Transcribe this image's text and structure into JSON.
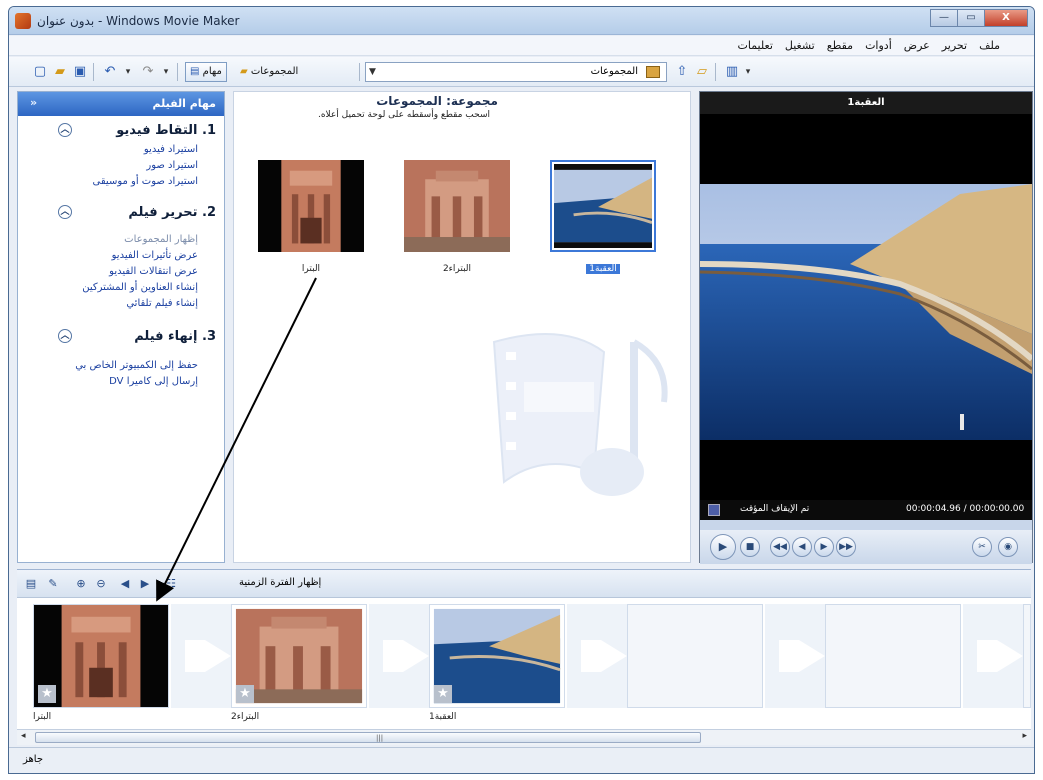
{
  "window": {
    "title": "بدون عنوان - Windows Movie Maker",
    "btn_min": "—",
    "btn_max": "▭",
    "btn_close": "X"
  },
  "menu": [
    "ملف",
    "تحرير",
    "عرض",
    "أدوات",
    "مقطع",
    "تشغيل",
    "تعليمات"
  ],
  "toolbar": {
    "tasks_label": "مهام",
    "collections_label": "المجموعات",
    "combo_value": "المجموعات"
  },
  "tasks": {
    "header": "مهام الفيلم",
    "close_glyph": "«",
    "sections": [
      {
        "title": "1. التقاط فيديو",
        "links": [
          "استيراد فيديو",
          "استيراد صور",
          "استيراد صوت أو موسيقى"
        ]
      },
      {
        "title": "2. تحرير فيلم",
        "links": [
          "إظهار المجموعات",
          "عرض تأثيرات الفيديو",
          "عرض انتقالات الفيديو",
          "إنشاء العناوين أو المشتركين",
          "إنشاء فيلم تلقائي"
        ]
      },
      {
        "title": "3. إنهاء فيلم",
        "links": [
          "حفظ إلى الكمبيوتر الخاص بي",
          "إرسال إلى كاميرا DV"
        ]
      }
    ]
  },
  "collection": {
    "title": "مجموعة: المجموعات",
    "hint": "اسحب مقطع وأسقطه على لوحة تحميل أعلاه.",
    "clips": [
      {
        "label": "العقبة1",
        "selected": true
      },
      {
        "label": "البتراء2",
        "selected": false
      },
      {
        "label": "البترا",
        "selected": false
      }
    ]
  },
  "preview": {
    "title": "العقبة1",
    "state": "تم الإيقاف المؤقت",
    "time": "00:00:04.96 / 00:00:00.00"
  },
  "storyboard": {
    "timeline_label": "إظهار الفترة الزمنية",
    "captions": [
      "البترا",
      "البتراء2",
      "العقبة1"
    ]
  },
  "scroll": {
    "grip": "|||"
  },
  "status": "جاهز"
}
